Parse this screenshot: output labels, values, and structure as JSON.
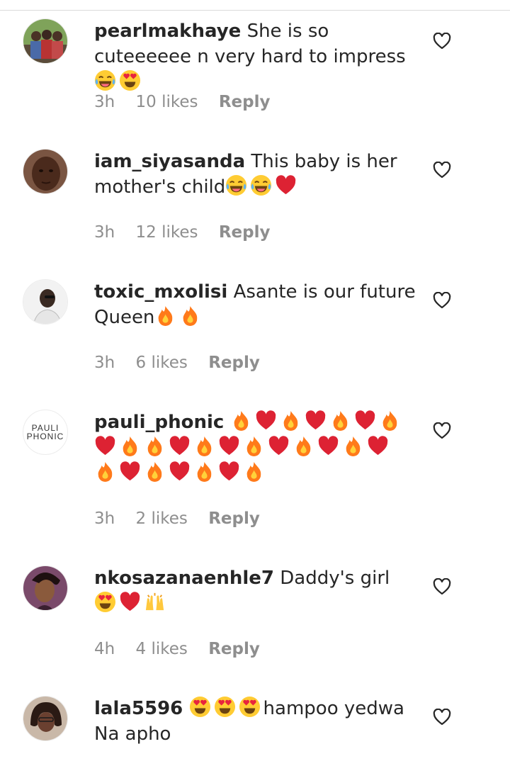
{
  "comments": [
    {
      "username": "pearlmakhaye",
      "text": "She is so cuteeeeee n very hard to impress",
      "emoji": [
        "laugh-cry",
        "heart-eyes"
      ],
      "time": "3h",
      "likes": "10 likes",
      "reply": "Reply"
    },
    {
      "username": "iam_siyasanda",
      "text": "This baby is her mother's child",
      "emoji": [
        "laugh-cry",
        "laugh-cry",
        "red-heart"
      ],
      "time": "3h",
      "likes": "12 likes",
      "reply": "Reply"
    },
    {
      "username": "toxic_mxolisi",
      "text": "Asante is our future Queen",
      "emoji": [
        "fire",
        "fire"
      ],
      "time": "3h",
      "likes": "6 likes",
      "reply": "Reply"
    },
    {
      "username": "pauli_phonic",
      "text": "",
      "emoji": [
        "fire",
        "red-heart",
        "fire",
        "red-heart",
        "fire",
        "red-heart",
        "fire",
        "red-heart",
        "fire",
        "fire",
        "red-heart",
        "fire",
        "red-heart",
        "fire",
        "red-heart",
        "fire",
        "red-heart",
        "fire",
        "red-heart",
        "fire",
        "red-heart",
        "fire",
        "red-heart",
        "fire",
        "red-heart",
        "fire"
      ],
      "avatar_text": [
        "PAULI",
        "PHONIC"
      ],
      "time": "3h",
      "likes": "2 likes",
      "reply": "Reply"
    },
    {
      "username": "nkosazanaenhle7",
      "text": "Daddy's girl",
      "emoji": [
        "heart-eyes",
        "red-heart",
        "raised-hands"
      ],
      "time": "4h",
      "likes": "4 likes",
      "reply": "Reply"
    },
    {
      "username": "lala5596",
      "text": "hampoo yedwa Na apho",
      "emoji": [
        "heart-eyes",
        "heart-eyes",
        "heart-eyes"
      ],
      "time": "",
      "likes": "",
      "reply": ""
    }
  ],
  "icons": {
    "like": "heart-outline-icon"
  }
}
